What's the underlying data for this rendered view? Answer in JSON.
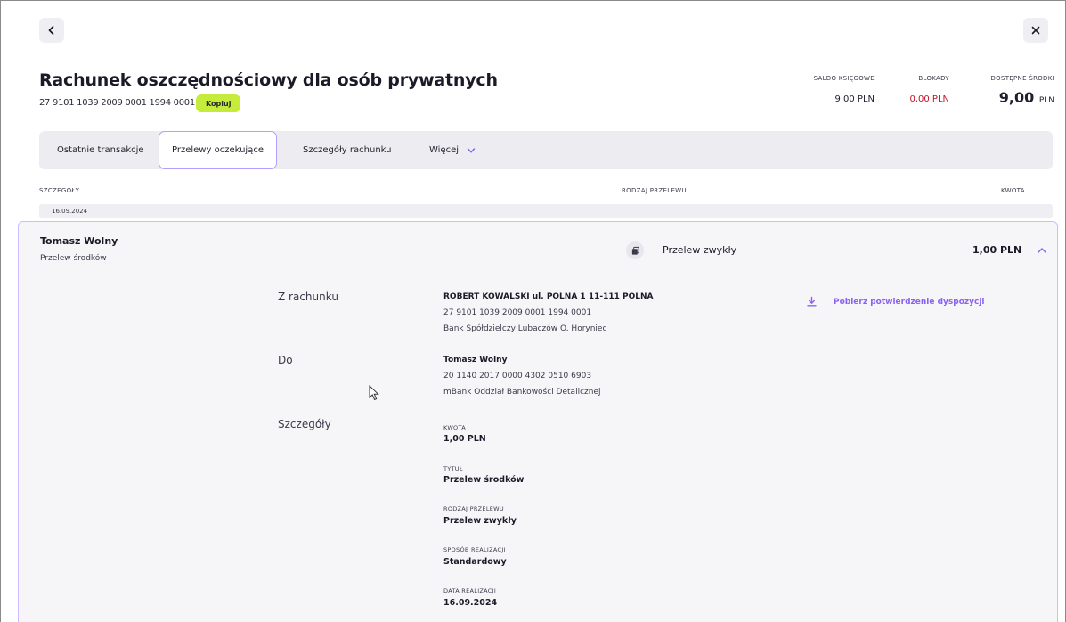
{
  "header": {
    "title": "Rachunek oszczędnościowy dla osób prywatnych",
    "account_number": "27 9101 1039 2009 0001 1994 0001",
    "copy_label": "Kopiuj",
    "back_icon": "chevron-left-icon",
    "close_icon": "close-icon"
  },
  "balances": {
    "saldo": {
      "label": "SALDO KSIĘGOWE",
      "value": "9,00 PLN"
    },
    "blokady": {
      "label": "BLOKADY",
      "value": "0,00 PLN"
    },
    "dostepne": {
      "label": "DOSTĘPNE ŚRODKI",
      "amount": "9,00",
      "currency": "PLN"
    }
  },
  "tabs": [
    {
      "label": "Ostatnie transakcje",
      "active": false
    },
    {
      "label": "Przelewy oczekujące",
      "active": true
    },
    {
      "label": "Szczegóły rachunku",
      "active": false
    },
    {
      "label": "Więcej",
      "active": false
    }
  ],
  "columns": {
    "details": "SZCZEGÓŁY",
    "type": "RODZAJ PRZELEWU",
    "amount": "KWOTA"
  },
  "group_date": "16.09.2024",
  "transfer": {
    "name": "Tomasz Wolny",
    "subtitle": "Przelew środków",
    "type": "Przelew zwykły",
    "amount": "1,00 PLN",
    "from": {
      "label": "Z rachunku",
      "owner": "ROBERT KOWALSKI ul. POLNA 1 11-111 POLNA",
      "account": "27 9101 1039 2009 0001 1994 0001",
      "bank": "Bank Spółdzielczy Lubaczów O. Horyniec"
    },
    "to": {
      "label": "Do",
      "owner": "Tomasz Wolny",
      "account": "20 1140 2017 0000 4302 0510 6903",
      "bank": "mBank Oddział Bankowości Detalicznej"
    },
    "details": {
      "label": "Szczegóły",
      "fields": [
        {
          "key": "KWOTA",
          "value": "1,00 PLN"
        },
        {
          "key": "TYTUŁ",
          "value": "Przelew środków"
        },
        {
          "key": "RODZAJ PRZELEWU",
          "value": "Przelew zwykły"
        },
        {
          "key": "SPOSÓB REALIZACJI",
          "value": "Standardowy"
        },
        {
          "key": "DATA REALIZACJI",
          "value": "16.09.2024"
        }
      ]
    },
    "download_label": "Pobierz potwierdzenie dyspozycji"
  },
  "colors": {
    "accent": "#8a63f0",
    "copy_bg": "#c5ec3b",
    "negative": "#c4152b",
    "active_border": "#b39dff"
  }
}
